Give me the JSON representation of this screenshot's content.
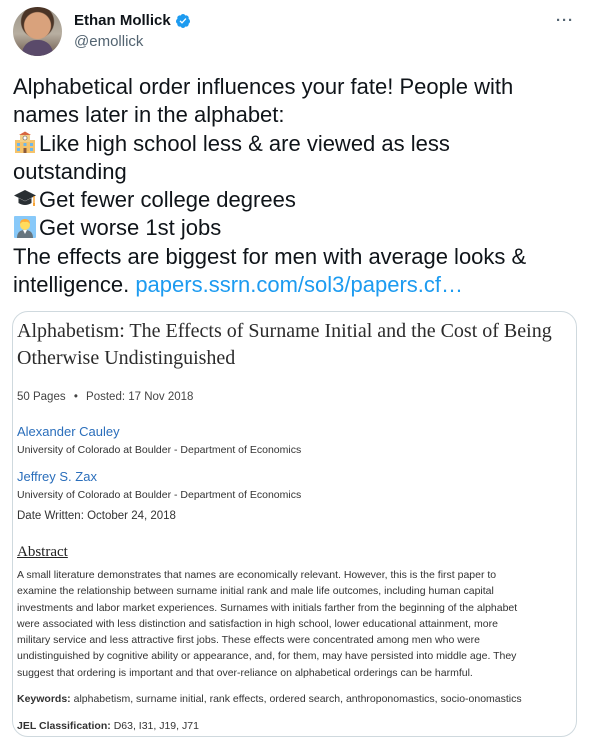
{
  "author": {
    "display_name": "Ethan Mollick",
    "handle": "@emollick",
    "verified": true,
    "more_icon": "more-horizontal-icon"
  },
  "tweet": {
    "line1": "Alphabetical order influences your fate! People with",
    "line2": "names later in the alphabet:",
    "line3": "Like high school less & are viewed as less",
    "line4": "outstanding",
    "line5": "Get fewer college degrees",
    "line6": "Get worse 1st jobs",
    "line7": "The effects are biggest for men with average looks &",
    "line8_text": "intelligence.",
    "link": "papers.ssrn.com/sol3/papers.cf…",
    "emoji": [
      "school-icon",
      "graduation-cap-icon",
      "office-worker-icon"
    ]
  },
  "card": {
    "title": "Alphabetism: The Effects of Surname Initial and the Cost of Being Otherwise Undistinguished",
    "pages": "50 Pages",
    "separator": "•",
    "posted": "Posted: 17 Nov 2018",
    "authors": [
      {
        "name": "Alexander Cauley",
        "affiliation": "University of Colorado at Boulder - Department of Economics"
      },
      {
        "name": "Jeffrey S. Zax",
        "affiliation": "University of Colorado at Boulder - Department of Economics"
      }
    ],
    "date_written": "Date Written: October 24, 2018",
    "abstract_heading": "Abstract",
    "abstract_lines": [
      "A small literature demonstrates that names are economically relevant. However, this is the first paper to",
      "examine the relationship between surname initial rank and male life outcomes, including human capital",
      "investments and labor market experiences. Surnames with initials farther from the beginning of the alphabet",
      "were associated with less distinction and satisfaction in high school, lower educational attainment, more",
      "military service and less attractive first jobs. These effects were concentrated among men who were",
      "undistinguished by cognitive ability or appearance, and, for them, may have persisted into middle age. They",
      "suggest that ordering is important and that over-reliance on alphabetical orderings can be harmful."
    ],
    "keywords_label": "Keywords:",
    "keywords": "alphabetism, surname initial, rank effects, ordered search, anthroponomastics, socio-onomastics",
    "jel_label": "JEL Classification:",
    "jel": "D63, I31, J19, J71"
  },
  "colors": {
    "link": "#1d9bf0",
    "verified": "#1d9bf0",
    "author_link": "#2a6ebb",
    "text": "#0f1419",
    "secondary": "#536471"
  }
}
